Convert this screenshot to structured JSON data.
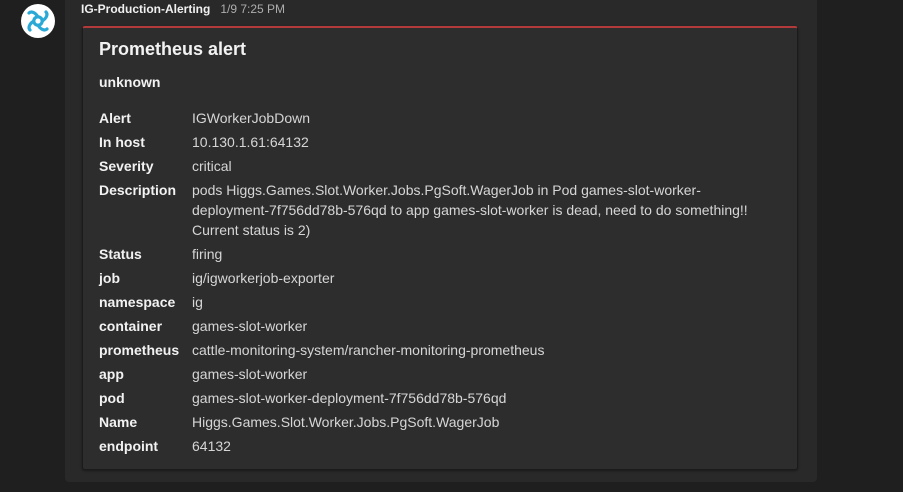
{
  "message": {
    "sender": "IG-Production-Alerting",
    "timestamp": "1/9 7:25 PM",
    "avatar_icon": "bot-logo-icon"
  },
  "card": {
    "accent_color": "#b23a3a",
    "title": "Prometheus alert",
    "subtitle": "unknown",
    "facts": [
      {
        "key": "Alert",
        "value": "IGWorkerJobDown"
      },
      {
        "key": "In host",
        "value": "10.130.1.61:64132"
      },
      {
        "key": "Severity",
        "value": "critical"
      },
      {
        "key": "Description",
        "value": "pods Higgs.Games.Slot.Worker.Jobs.PgSoft.WagerJob in Pod games-slot-worker-deployment-7f756dd78b-576qd to app games-slot-worker is dead, need to do something!! Current status is 2)"
      },
      {
        "key": "Status",
        "value": "firing"
      },
      {
        "key": "job",
        "value": "ig/igworkerjob-exporter"
      },
      {
        "key": "namespace",
        "value": "ig"
      },
      {
        "key": "container",
        "value": "games-slot-worker"
      },
      {
        "key": "prometheus",
        "value": "cattle-monitoring-system/rancher-monitoring-prometheus"
      },
      {
        "key": "app",
        "value": "games-slot-worker"
      },
      {
        "key": "pod",
        "value": "games-slot-worker-deployment-7f756dd78b-576qd"
      },
      {
        "key": "Name",
        "value": "Higgs.Games.Slot.Worker.Jobs.PgSoft.WagerJob"
      },
      {
        "key": "endpoint",
        "value": "64132"
      }
    ]
  }
}
